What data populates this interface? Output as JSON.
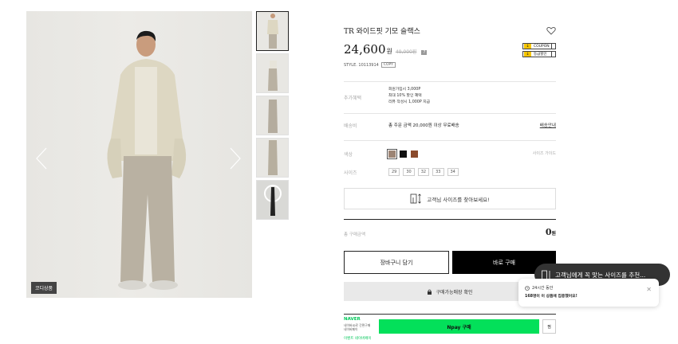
{
  "product": {
    "title": "TR 와이드핏 기모 슬랙스",
    "price": "24,600",
    "price_unit": "원",
    "original_price": "49,000원",
    "style_label": "STYLE. 10113914",
    "copy_label": "COPY"
  },
  "coupons": [
    {
      "label": "COUPON"
    },
    {
      "label": "등급할인"
    }
  ],
  "gallery": {
    "badge": "코디상품"
  },
  "benefit": {
    "label": "추가혜택",
    "lines": [
      "회원가입시 3,000P",
      "최대 10% 할인 혜택",
      "리뷰 작성시 1,000P 지급"
    ]
  },
  "shipping": {
    "label": "배송비",
    "text": "총 주문 금액 20,000원 이상 무료배송",
    "link": "배송안내"
  },
  "color": {
    "label": "색상",
    "swatches": [
      "#9c8474",
      "#111111",
      "#8a4a2c"
    ],
    "size_guide": "사이즈 가이드"
  },
  "size": {
    "label": "사이즈",
    "options": [
      "29",
      "30",
      "32",
      "33",
      "34"
    ]
  },
  "find_size": {
    "label": "고객님 사이즈를 찾아보세요!"
  },
  "total": {
    "label": "총 구매금액",
    "value": "0",
    "unit": "원"
  },
  "actions": {
    "cart": "장바구니 담기",
    "buy": "바로 구매",
    "store_check": "구매가능매장 확인"
  },
  "naver": {
    "logo": "NAVER",
    "sub1": "네이버ID로 간편구매",
    "sub2": "네이버페이",
    "pay": "Npay 구매",
    "zzim": "찜",
    "footer": "이벤트 네이버페이"
  },
  "toast": {
    "text": "고객님에게 꼭 맞는 사이즈를 추천..."
  },
  "popup": {
    "line1": "24시간 동안",
    "line2": "168명이 이 상품에 집중했어요!"
  }
}
